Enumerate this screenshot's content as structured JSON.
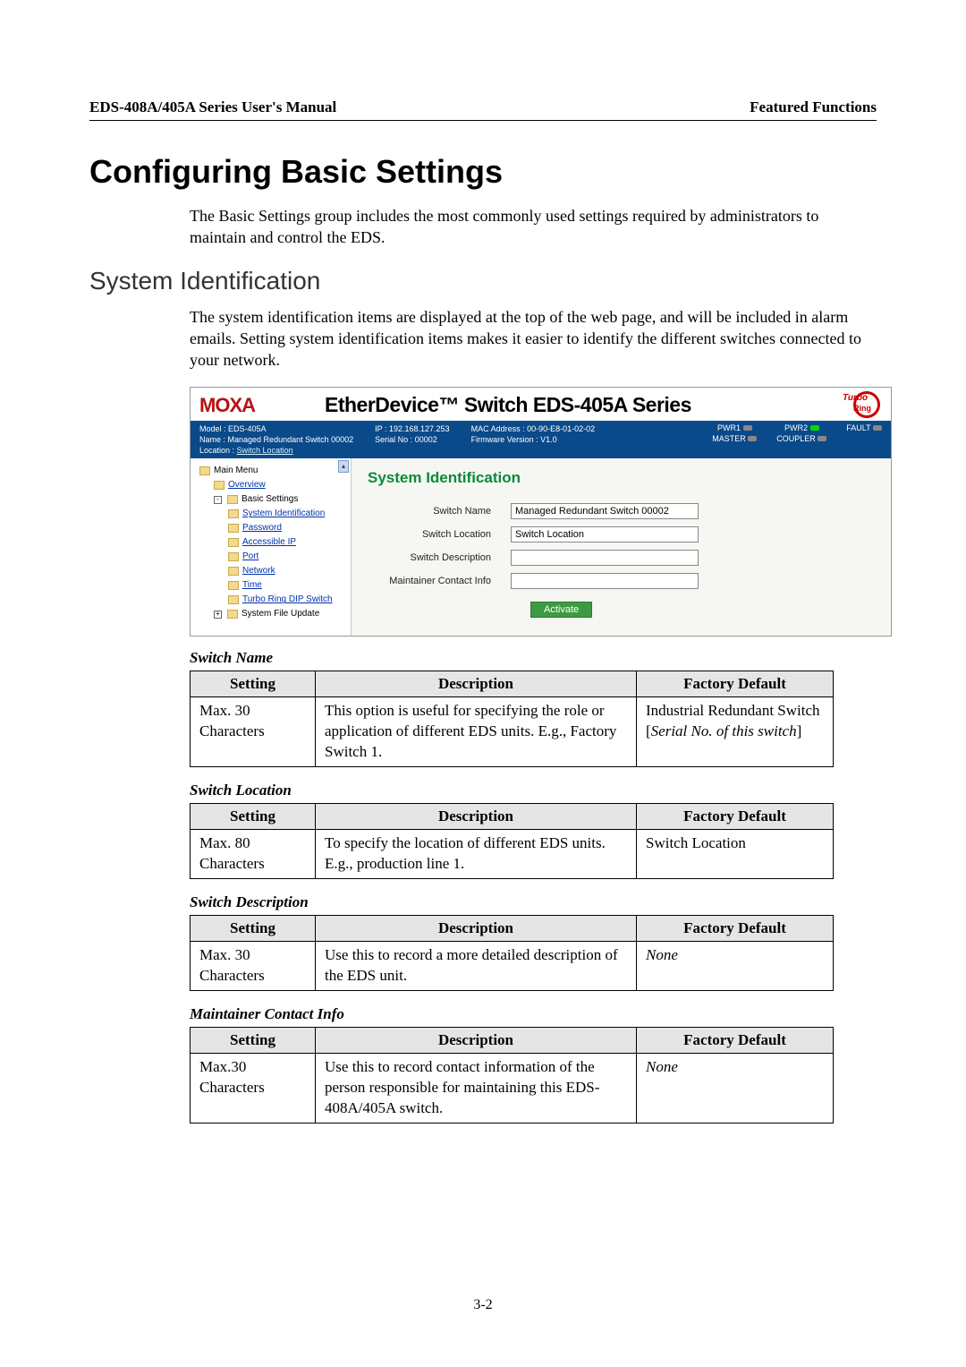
{
  "header": {
    "left": "EDS-408A/405A Series User's Manual",
    "right": "Featured Functions"
  },
  "h1": "Configuring Basic Settings",
  "intro": "The Basic Settings group includes the most commonly used settings required by administrators to maintain and control the EDS.",
  "h2": "System Identification",
  "subintro": "The system identification items are displayed at the top of the web page, and will be included in alarm emails. Setting system identification items makes it easier to identify the different switches connected to your network.",
  "screenshot": {
    "logo": "MOXA",
    "product": "EtherDevice™ Switch EDS-405A Series",
    "turbo1": "Turbo",
    "turbo2": "Ring",
    "status": {
      "model_label": "Model :",
      "model": "EDS-405A",
      "name_label": "Name :",
      "name": "Managed Redundant Switch 00002",
      "location_label": "Location :",
      "location": "Switch Location",
      "ip_label": "IP :",
      "ip": "192.168.127.253",
      "serial_label": "Serial No :",
      "serial": "00002",
      "mac_label": "MAC Address :",
      "mac": "00-90-E8-01-02-02",
      "fw_label": "Firmware Version :",
      "fw": "V1.0",
      "leds": {
        "pwr1": "PWR1",
        "master": "MASTER",
        "pwr2": "PWR2",
        "coupler": "COUPLER",
        "fault": "FAULT"
      }
    },
    "tree": {
      "main": "Main Menu",
      "overview": "Overview",
      "basic": "Basic Settings",
      "sysid": "System Identification",
      "password": "Password",
      "accessibleip": "Accessible IP",
      "port": "Port",
      "network": "Network",
      "time": "Time",
      "turbodip": "Turbo Ring DIP Switch",
      "sysfile": "System File Update"
    },
    "panel": {
      "title": "System Identification",
      "fields": {
        "switch_name_label": "Switch Name",
        "switch_name_value": "Managed Redundant Switch 00002",
        "switch_location_label": "Switch Location",
        "switch_location_value": "Switch Location",
        "switch_description_label": "Switch Description",
        "switch_description_value": "",
        "maintainer_label": "Maintainer Contact Info",
        "maintainer_value": ""
      },
      "activate": "Activate"
    }
  },
  "tables": {
    "headers": {
      "setting": "Setting",
      "description": "Description",
      "default": "Factory Default"
    },
    "switch_name": {
      "caption": "Switch Name",
      "setting": "Max. 30 Characters",
      "description": "This option is useful for specifying the role or application of different EDS units. E.g., Factory Switch 1.",
      "default_prefix": "Industrial Redundant Switch [",
      "default_italic": "Serial No. of this switch",
      "default_suffix": "]"
    },
    "switch_location": {
      "caption": "Switch Location",
      "setting": "Max. 80 Characters",
      "description": "To specify the location of different EDS units. E.g., production line 1.",
      "default": "Switch Location"
    },
    "switch_description": {
      "caption": "Switch Description",
      "setting": "Max. 30 Characters",
      "description": "Use this to record a more detailed description of the EDS unit.",
      "default": "None"
    },
    "maintainer": {
      "caption": "Maintainer Contact Info",
      "setting": "Max.30 Characters",
      "description": "Use this to record contact information of the person responsible for maintaining this EDS-408A/405A switch.",
      "default": "None"
    }
  },
  "page_number": "3-2"
}
